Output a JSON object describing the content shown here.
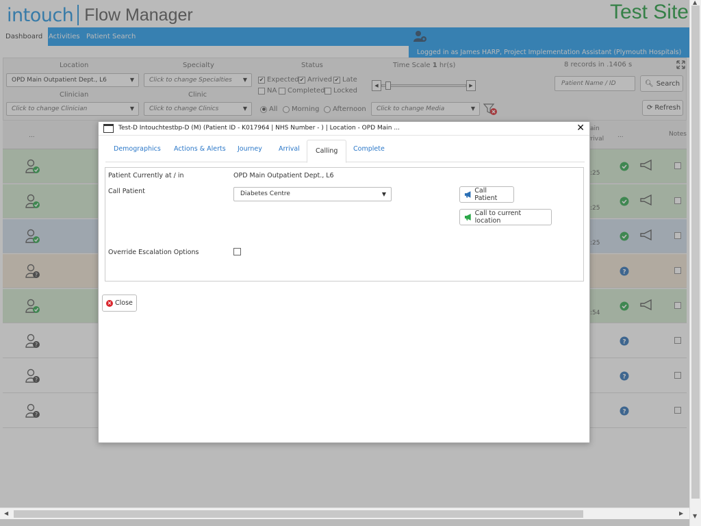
{
  "header": {
    "brand_primary": "intouch",
    "brand_secondary": "Flow Manager",
    "site_label": "Test Site",
    "nav": [
      {
        "label": "Dashboard",
        "active": true
      },
      {
        "label": "Activities",
        "active": false
      },
      {
        "label": "Patient Search",
        "active": false
      }
    ],
    "logged_in": "Logged in as James HARP, Project Implementation Assistant (Plymouth Hospitals)"
  },
  "filters": {
    "location_label": "Location",
    "location_value": "OPD Main Outpatient Dept., L6",
    "specialty_label": "Specialty",
    "specialty_placeholder": "Click to change Specialties",
    "clinician_label": "Clinician",
    "clinician_placeholder": "Click to change Clinician",
    "clinic_label": "Clinic",
    "clinic_placeholder": "Click to change Clinics",
    "status_label": "Status",
    "status_options": [
      {
        "label": "Expected",
        "checked": true
      },
      {
        "label": "Arrived",
        "checked": true
      },
      {
        "label": "Late",
        "checked": true
      },
      {
        "label": "NA",
        "checked": false
      },
      {
        "label": "Completed",
        "checked": false
      },
      {
        "label": "Locked",
        "checked": false
      }
    ],
    "period_options": [
      {
        "label": "All",
        "selected": true
      },
      {
        "label": "Morning",
        "selected": false
      },
      {
        "label": "Afternoon",
        "selected": false
      }
    ],
    "timescale_label": "Time Scale",
    "timescale_value": "1",
    "timescale_unit": "hr(s)",
    "timescale_slider_fraction": 0.05,
    "media_placeholder": "Click to change Media",
    "records_info": "8 records in .1406 s",
    "patient_search_placeholder": "Patient Name / ID",
    "search_label": "Search",
    "refresh_label": "Refresh"
  },
  "grid": {
    "header_dots": "...",
    "header_arrival": "rrival",
    "header_main": "ain",
    "header_dots2": "...",
    "header_notes": "Notes",
    "rows": [
      {
        "color": "#d3e9cf",
        "status": "arrived",
        "time": ":25"
      },
      {
        "color": "#d3e9cf",
        "status": "arrived",
        "time": ":25"
      },
      {
        "color": "#cfdcea",
        "status": "arrived",
        "time": ":25"
      },
      {
        "color": "#f0e3d2",
        "status": "expected",
        "time": ""
      },
      {
        "color": "#d3e9cf",
        "status": "arrived",
        "time": ":54"
      },
      {
        "color": "#ffffff",
        "status": "expected",
        "time": ""
      },
      {
        "color": "#ffffff",
        "status": "expected",
        "time": ""
      },
      {
        "color": "#ffffff",
        "status": "expected",
        "time": ""
      }
    ]
  },
  "modal": {
    "title": "Test-D Intouchtestbp-D (M) (Patient ID - K017964 | NHS Number - ) | Location - OPD Main ...",
    "tabs": [
      {
        "label": "Demographics",
        "active": false
      },
      {
        "label": "Actions & Alerts",
        "active": false
      },
      {
        "label": "Journey",
        "active": false
      },
      {
        "label": "Arrival",
        "active": false
      },
      {
        "label": "Calling",
        "active": true
      },
      {
        "label": "Complete",
        "active": false
      }
    ],
    "current_label": "Patient Currently at / in",
    "current_value": "OPD Main Outpatient Dept., L6",
    "call_label": "Call Patient",
    "call_select_value": "Diabetes Centre",
    "call_button": "Call Patient",
    "call_current_button": "Call to current location",
    "override_label": "Override Escalation Options",
    "override_checked": false,
    "close_label": "Close"
  },
  "colors": {
    "brand_blue": "#1e9bf0",
    "site_green": "#1a9b3a",
    "link_blue": "#2a77c8",
    "ok_green": "#2ca84a",
    "help_blue": "#2a6fb5"
  }
}
